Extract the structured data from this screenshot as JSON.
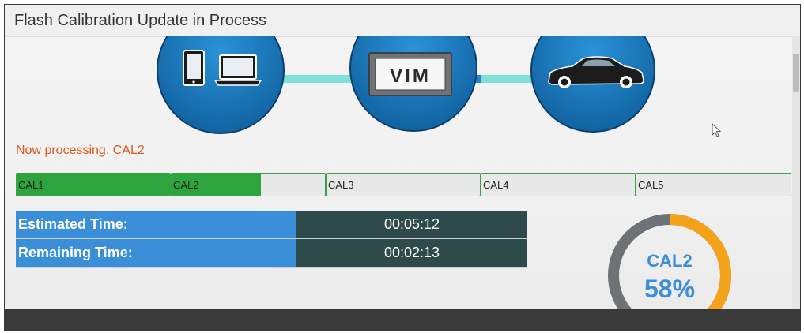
{
  "window": {
    "title": "Flash Calibration Update in Process"
  },
  "diagram": {
    "nodes": [
      {
        "name": "devices",
        "icons": [
          "tablet-icon",
          "laptop-icon"
        ]
      },
      {
        "name": "vim",
        "label": "VIM"
      },
      {
        "name": "vehicle",
        "icons": [
          "car-icon"
        ]
      }
    ],
    "colors": {
      "node": "#1a7fc6",
      "link": "#7fe0d8",
      "box": "#6f7377"
    }
  },
  "status": {
    "text": "Now processing. CAL2",
    "color": "#e0571b"
  },
  "calibrations": [
    {
      "label": "CAL1",
      "progress": 1.0
    },
    {
      "label": "CAL2",
      "progress": 0.58
    },
    {
      "label": "CAL3",
      "progress": 0
    },
    {
      "label": "CAL4",
      "progress": 0
    },
    {
      "label": "CAL5",
      "progress": 0
    }
  ],
  "times": [
    {
      "label": "Estimated Time:",
      "value": "00:05:12"
    },
    {
      "label": "Remaining Time:",
      "value": "00:02:13"
    }
  ],
  "gauge": {
    "label": "CAL2",
    "percent_text": "58%",
    "fraction": 0.58,
    "colors": {
      "progress": "#f5a21b",
      "track": "#6e7175",
      "text": "#3b8fd8"
    }
  }
}
